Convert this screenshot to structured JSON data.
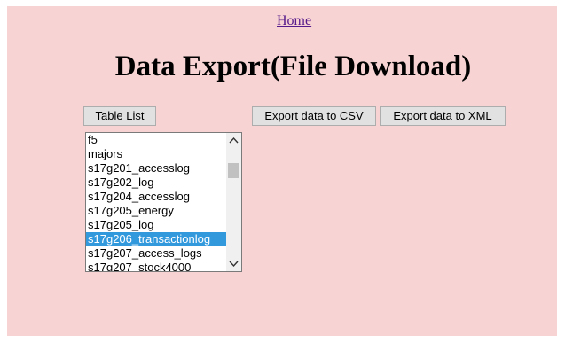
{
  "nav": {
    "home_label": "Home"
  },
  "page": {
    "title": "Data Export(File Download)",
    "background_color": "#f8d3d3"
  },
  "toolbar": {
    "table_list_label": "Table List",
    "export_csv_label": "Export data to CSV",
    "export_xml_label": "Export data to XML"
  },
  "table_list": {
    "items": [
      "f5",
      "majors",
      "s17g201_accesslog",
      "s17g202_log",
      "s17g204_accesslog",
      "s17g205_energy",
      "s17g205_log",
      "s17g206_transactionlog",
      "s17g207_access_logs",
      "s17g207_stock4000"
    ],
    "selected": "s17g206_transactionlog",
    "selected_color": "#3399dd"
  }
}
